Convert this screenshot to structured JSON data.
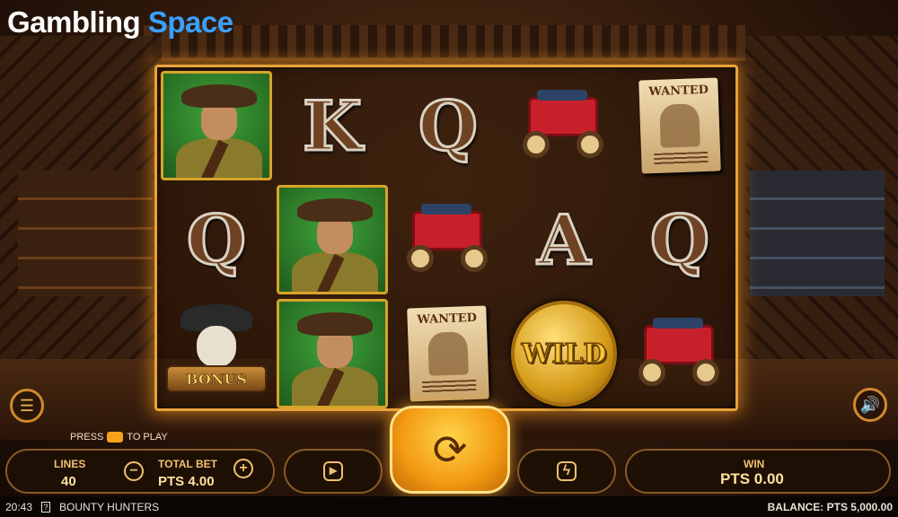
{
  "logo": {
    "word1": "Gambling",
    "word2": "Space"
  },
  "reels": [
    [
      {
        "type": "hunter"
      },
      {
        "type": "letter",
        "text": "Q"
      },
      {
        "type": "bonus",
        "label": "BONUS"
      }
    ],
    [
      {
        "type": "letter",
        "text": "K"
      },
      {
        "type": "hunter"
      },
      {
        "type": "hunter"
      }
    ],
    [
      {
        "type": "letter",
        "text": "Q"
      },
      {
        "type": "coach"
      },
      {
        "type": "wanted",
        "label": "WANTED"
      }
    ],
    [
      {
        "type": "coach"
      },
      {
        "type": "letter",
        "text": "A"
      },
      {
        "type": "wild",
        "label": "WILD"
      }
    ],
    [
      {
        "type": "wanted",
        "label": "WANTED"
      },
      {
        "type": "letter",
        "text": "Q"
      },
      {
        "type": "coach"
      }
    ]
  ],
  "controls": {
    "press_prefix": "PRESS",
    "press_suffix": "TO PLAY",
    "lines_label": "LINES",
    "lines_value": "40",
    "minus_label": "−",
    "plus_label": "+",
    "total_bet_label": "TOTAL BET",
    "total_bet_value": "PTS 4.00",
    "win_label": "WIN",
    "win_value": "PTS 0.00",
    "menu_icon": "menu-icon",
    "sound_icon": "speaker-icon",
    "autoplay_icon": "autoplay-icon",
    "spin_icon": "spin-arrows-icon",
    "turbo_icon": "lightning-icon"
  },
  "footer": {
    "time": "20:43",
    "help": "?",
    "game_name": "BOUNTY HUNTERS",
    "balance": "BALANCE: PTS 5,000.00"
  },
  "colors": {
    "accent": "#f39a12",
    "frame": "#e8a23a",
    "logo_space": "#3aa0ff"
  }
}
